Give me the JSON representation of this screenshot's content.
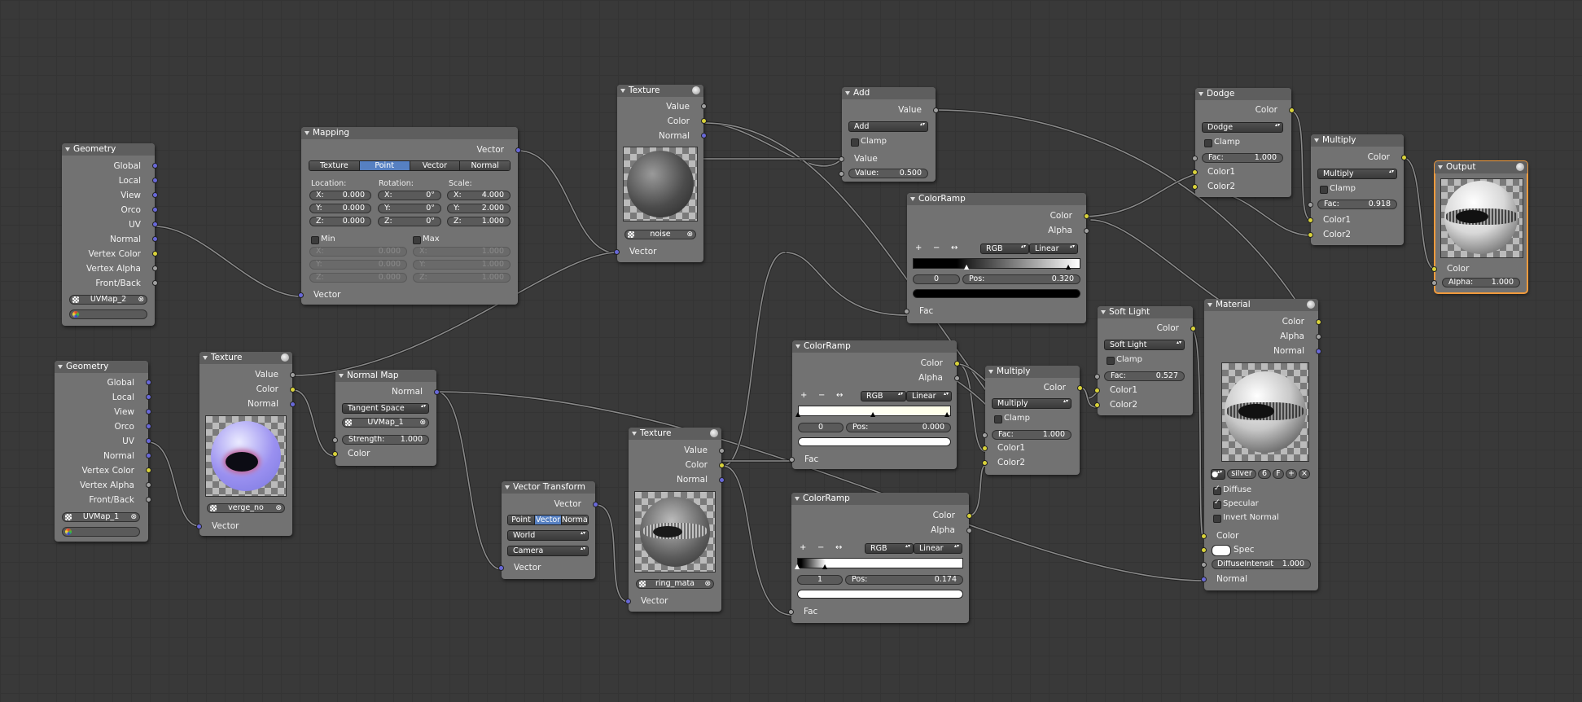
{
  "colors": {
    "socket_color": "#d8d23a",
    "socket_vector": "#6868d8",
    "socket_value": "#a0a0a0",
    "selection": "#5680c2",
    "active_outline": "#f09a3c"
  },
  "geo1": {
    "title": "Geometry",
    "outputs": [
      "Global",
      "Local",
      "View",
      "Orco",
      "UV",
      "Normal",
      "Vertex Color",
      "Vertex Alpha",
      "Front/Back"
    ],
    "uv": "UVMap_2"
  },
  "geo2": {
    "title": "Geometry",
    "outputs": [
      "Global",
      "Local",
      "View",
      "Orco",
      "UV",
      "Normal",
      "Vertex Color",
      "Vertex Alpha",
      "Front/Back"
    ],
    "uv": "UVMap_1"
  },
  "mapping": {
    "title": "Mapping",
    "out": "Vector",
    "modes": [
      "Texture",
      "Point",
      "Vector",
      "Normal"
    ],
    "active_mode": "Point",
    "location_label": "Location:",
    "rotation_label": "Rotation:",
    "scale_label": "Scale:",
    "loc": [
      {
        "k": "X:",
        "v": "0.000"
      },
      {
        "k": "Y:",
        "v": "0.000"
      },
      {
        "k": "Z:",
        "v": "0.000"
      }
    ],
    "rot": [
      {
        "k": "X:",
        "v": "0°"
      },
      {
        "k": "Y:",
        "v": "0°"
      },
      {
        "k": "Z:",
        "v": "0°"
      }
    ],
    "scale": [
      {
        "k": "X:",
        "v": "4.000"
      },
      {
        "k": "Y:",
        "v": "2.000"
      },
      {
        "k": "Z:",
        "v": "1.000"
      }
    ],
    "min": "Min",
    "max": "Max",
    "minv": [
      {
        "k": "X:",
        "v": "0.000"
      },
      {
        "k": "Y:",
        "v": "0.000"
      },
      {
        "k": "Z:",
        "v": "0.000"
      }
    ],
    "maxv": [
      {
        "k": "X:",
        "v": "1.000"
      },
      {
        "k": "Y:",
        "v": "1.000"
      },
      {
        "k": "Z:",
        "v": "1.000"
      }
    ],
    "in": "Vector"
  },
  "tex1": {
    "title": "Texture",
    "outputs": [
      "Value",
      "Color",
      "Normal"
    ],
    "image": "noise",
    "in": "Vector"
  },
  "tex2": {
    "title": "Texture",
    "outputs": [
      "Value",
      "Color",
      "Normal"
    ],
    "image": "verge_no",
    "in": "Vector"
  },
  "tex3": {
    "title": "Texture",
    "outputs": [
      "Value",
      "Color",
      "Normal"
    ],
    "image": "ring_mata",
    "in": "Vector"
  },
  "normalmap": {
    "title": "Normal Map",
    "out": "Normal",
    "space": "Tangent Space",
    "uv": "UVMap_1",
    "strength_label": "Strength:",
    "strength": "1.000",
    "in": "Color"
  },
  "vtrans": {
    "title": "Vector Transform",
    "out": "Vector",
    "modes": [
      "Point",
      "Vector",
      "Normal"
    ],
    "active_mode": "Vector",
    "from": "World",
    "to": "Camera",
    "in": "Vector"
  },
  "add": {
    "title": "Add",
    "out": "Value",
    "op": "Add",
    "clamp": "Clamp",
    "in1": "Value",
    "value_label": "Value:",
    "value": "0.500"
  },
  "ramp1": {
    "title": "ColorRamp",
    "outputs": [
      "Color",
      "Alpha"
    ],
    "mode": "RGB",
    "interp": "Linear",
    "index": "0",
    "pos_label": "Pos:",
    "pos": "0.320",
    "in": "Fac"
  },
  "ramp2": {
    "title": "ColorRamp",
    "outputs": [
      "Color",
      "Alpha"
    ],
    "mode": "RGB",
    "interp": "Linear",
    "index": "0",
    "pos_label": "Pos:",
    "pos": "0.000",
    "in": "Fac"
  },
  "ramp3": {
    "title": "ColorRamp",
    "outputs": [
      "Color",
      "Alpha"
    ],
    "mode": "RGB",
    "interp": "Linear",
    "index": "1",
    "pos_label": "Pos:",
    "pos": "0.174",
    "in": "Fac"
  },
  "multiply_mid": {
    "title": "Multiply",
    "out": "Color",
    "op": "Multiply",
    "clamp": "Clamp",
    "fac_label": "Fac:",
    "fac": "1.000",
    "in1": "Color1",
    "in2": "Color2"
  },
  "dodge": {
    "title": "Dodge",
    "out": "Color",
    "op": "Dodge",
    "clamp": "Clamp",
    "fac_label": "Fac:",
    "fac": "1.000",
    "in1": "Color1",
    "in2": "Color2"
  },
  "softlight": {
    "title": "Soft Light",
    "out": "Color",
    "op": "Soft Light",
    "clamp": "Clamp",
    "fac_label": "Fac:",
    "fac": "0.527",
    "in1": "Color1",
    "in2": "Color2"
  },
  "multiply_top": {
    "title": "Multiply",
    "out": "Color",
    "op": "Multiply",
    "clamp": "Clamp",
    "fac_label": "Fac:",
    "fac": "0.918",
    "in1": "Color1",
    "in2": "Color2"
  },
  "material": {
    "title": "Material",
    "outputs": [
      "Color",
      "Alpha",
      "Normal"
    ],
    "name": "silver",
    "users": "6",
    "fake": "F",
    "diffuse": "Diffuse",
    "specular": "Specular",
    "invert": "Invert Normal",
    "in_color": "Color",
    "in_spec": "Spec",
    "di_label": "DiffuseIntensit",
    "di_value": "1.000",
    "in_normal": "Normal"
  },
  "output": {
    "title": "Output",
    "in_color": "Color",
    "alpha_label": "Alpha:",
    "alpha": "1.000"
  }
}
